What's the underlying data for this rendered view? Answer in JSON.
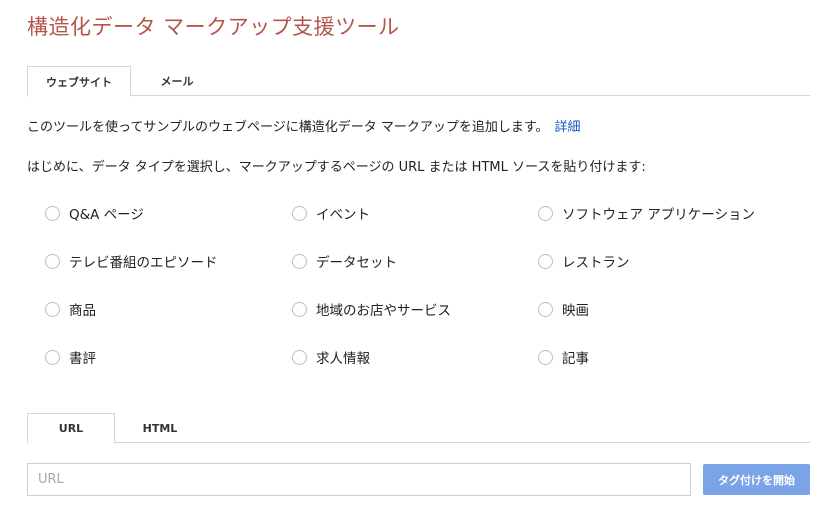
{
  "title": "構造化データ マークアップ支援ツール",
  "top_tabs": [
    {
      "label": "ウェブサイト",
      "active": true
    },
    {
      "label": "メール",
      "active": false
    }
  ],
  "intro": {
    "text": "このツールを使ってサンプルのウェブページに構造化データ マークアップを追加します。",
    "link_label": "詳細"
  },
  "instruction": "はじめに、データ タイプを選択し、マークアップするページの URL または HTML ソースを貼り付けます:",
  "data_types": [
    "Q&A ページ",
    "イベント",
    "ソフトウェア アプリケーション",
    "テレビ番組のエピソード",
    "データセット",
    "レストラン",
    "商品",
    "地域のお店やサービス",
    "映画",
    "書評",
    "求人情報",
    "記事"
  ],
  "source_tabs": [
    {
      "label": "URL",
      "active": true
    },
    {
      "label": "HTML",
      "active": false
    }
  ],
  "url_input": {
    "placeholder": "URL",
    "value": ""
  },
  "start_button": "タグ付けを開始",
  "colors": {
    "title": "#b5554a",
    "link": "#1a55c4",
    "button": "#7aa3e8"
  }
}
